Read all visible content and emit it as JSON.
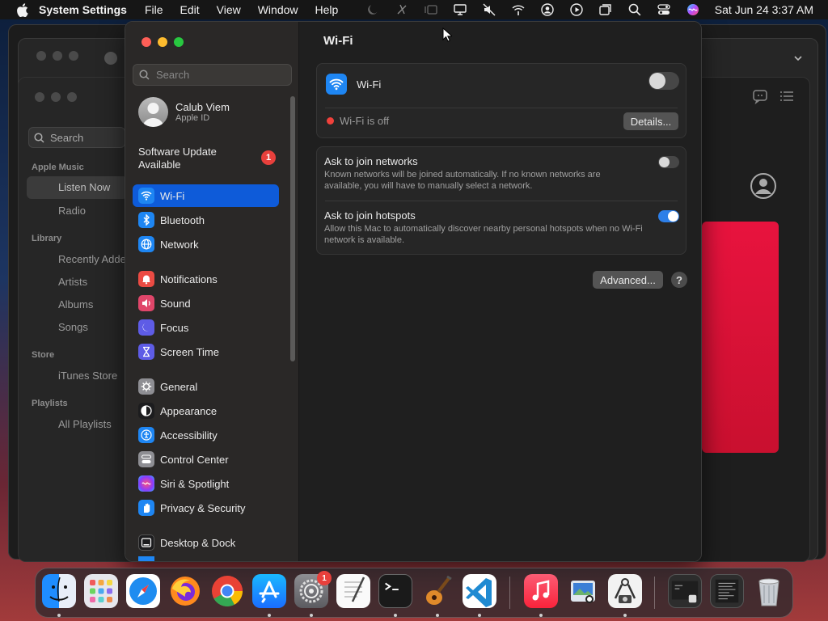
{
  "menubar": {
    "app_name": "System Settings",
    "menus": [
      "File",
      "Edit",
      "View",
      "Window",
      "Help"
    ],
    "status_icons": [
      "moon-icon",
      "cursor-off-icon",
      "stage-manager-icon",
      "display-icon",
      "mute-icon",
      "wifi-off-icon",
      "account-icon",
      "screen-record-icon",
      "screens-icon",
      "spotlight-icon",
      "control-center-icon",
      "siri-icon"
    ],
    "clock": "Sat Jun 24  3:37 AM"
  },
  "music": {
    "search_placeholder": "Search",
    "sections": [
      {
        "title": "Apple Music",
        "items": [
          "Listen Now",
          "Radio"
        ]
      },
      {
        "title": "Library",
        "items": [
          "Recently Added",
          "Artists",
          "Albums",
          "Songs"
        ]
      },
      {
        "title": "Store",
        "items": [
          "iTunes Store"
        ]
      },
      {
        "title": "Playlists",
        "items": [
          "All Playlists"
        ]
      }
    ]
  },
  "sidebar": {
    "search_placeholder": "Search",
    "user": {
      "name": "Calub Viem",
      "sub": "Apple ID"
    },
    "update": {
      "label": "Software Update Available",
      "badge": "1"
    },
    "items": [
      {
        "label": "Wi-Fi",
        "icon": "wifi-icon",
        "color": "#1e86f3",
        "selected": true
      },
      {
        "label": "Bluetooth",
        "icon": "bluetooth-icon",
        "color": "#1e86f3"
      },
      {
        "label": "Network",
        "icon": "globe-icon",
        "color": "#1e86f3"
      },
      {
        "label": "Notifications",
        "icon": "bell-icon",
        "color": "#eb4b43"
      },
      {
        "label": "Sound",
        "icon": "speaker-icon",
        "color": "#e0466a"
      },
      {
        "label": "Focus",
        "icon": "moon-icon",
        "color": "#5e5ce6"
      },
      {
        "label": "Screen Time",
        "icon": "hourglass-icon",
        "color": "#5e5ce6"
      },
      {
        "label": "General",
        "icon": "gear-icon",
        "color": "#8e8e93"
      },
      {
        "label": "Appearance",
        "icon": "appearance-icon",
        "color": "#1c1c1e"
      },
      {
        "label": "Accessibility",
        "icon": "accessibility-icon",
        "color": "#1e86f3"
      },
      {
        "label": "Control Center",
        "icon": "control-center-icon",
        "color": "#8e8e93"
      },
      {
        "label": "Siri & Spotlight",
        "icon": "siri-icon",
        "color": "#a040d0"
      },
      {
        "label": "Privacy & Security",
        "icon": "hand-icon",
        "color": "#1e86f3"
      },
      {
        "label": "Desktop & Dock",
        "icon": "dock-icon",
        "color": "#1c1c1e"
      }
    ]
  },
  "content": {
    "title": "Wi-Fi",
    "wifi": {
      "label": "Wi-Fi",
      "enabled": false,
      "status": "Wi-Fi is off",
      "details_button": "Details..."
    },
    "ask_networks": {
      "title": "Ask to join networks",
      "desc": "Known networks will be joined automatically. If no known networks are available, you will have to manually select a network.",
      "enabled": false
    },
    "ask_hotspots": {
      "title": "Ask to join hotspots",
      "desc": "Allow this Mac to automatically discover nearby personal hotspots when no Wi-Fi network is available.",
      "enabled": true
    },
    "advanced_button": "Advanced...",
    "help_button": "?"
  },
  "colors": {
    "accent": "#0e5bd9",
    "toggle_on": "#2d7fe8",
    "status_off": "#f0413b",
    "badge": "#e8403c"
  },
  "dock": {
    "apps": [
      {
        "name": "Finder",
        "icon": "finder-icon",
        "running": true
      },
      {
        "name": "Launchpad",
        "icon": "launchpad-icon",
        "running": false
      },
      {
        "name": "Safari",
        "icon": "safari-icon",
        "running": false
      },
      {
        "name": "Firefox",
        "icon": "firefox-icon",
        "running": false
      },
      {
        "name": "Chrome",
        "icon": "chrome-icon",
        "running": false
      },
      {
        "name": "App Store",
        "icon": "app-store-icon",
        "running": true
      },
      {
        "name": "System Settings",
        "icon": "settings-icon",
        "running": true,
        "badge": "1"
      },
      {
        "name": "TextEdit",
        "icon": "textedit-icon",
        "running": false
      },
      {
        "name": "Terminal",
        "icon": "terminal-icon",
        "running": true
      },
      {
        "name": "GarageBand",
        "icon": "garageband-icon",
        "running": true
      },
      {
        "name": "Visual Studio Code",
        "icon": "vscode-icon",
        "running": true
      },
      {
        "name": "Music",
        "icon": "music-icon",
        "running": true
      },
      {
        "name": "Preview",
        "icon": "preview-icon",
        "running": false
      },
      {
        "name": "Screenshot",
        "icon": "screenshot-icon",
        "running": true
      },
      {
        "name": "Recent Window 1",
        "icon": "window-thumbnail-icon",
        "running": false
      },
      {
        "name": "Recent Window 2",
        "icon": "document-thumbnail-icon",
        "running": false
      },
      {
        "name": "Trash",
        "icon": "trash-icon",
        "running": false
      }
    ]
  }
}
